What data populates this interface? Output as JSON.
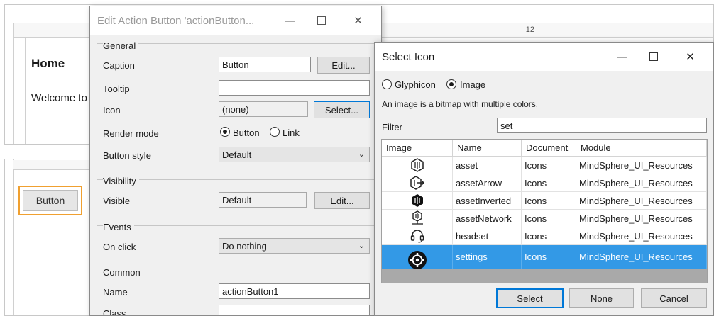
{
  "background": {
    "ruler_number": "12",
    "home_title": "Home",
    "welcome_text": "Welcome to",
    "page_button_label": "Button"
  },
  "edit_dialog": {
    "title": "Edit Action Button 'actionButton...",
    "groups": {
      "general": "General",
      "visibility": "Visibility",
      "events": "Events",
      "common": "Common"
    },
    "fields": {
      "caption_label": "Caption",
      "caption_value": "Button",
      "caption_edit": "Edit...",
      "tooltip_label": "Tooltip",
      "tooltip_value": "",
      "icon_label": "Icon",
      "icon_value": "(none)",
      "icon_select": "Select...",
      "render_mode_label": "Render mode",
      "render_mode_options": [
        "Button",
        "Link"
      ],
      "render_mode_selected": "Button",
      "button_style_label": "Button style",
      "button_style_value": "Default",
      "visible_label": "Visible",
      "visible_value": "Default",
      "visible_edit": "Edit...",
      "on_click_label": "On click",
      "on_click_value": "Do nothing",
      "name_label": "Name",
      "name_value": "actionButton1",
      "class_label": "Class",
      "class_value": ""
    }
  },
  "icon_dialog": {
    "title": "Select Icon",
    "type_options": [
      "Glyphicon",
      "Image"
    ],
    "type_selected": "Image",
    "description": "An image is a bitmap with multiple colors.",
    "filter_label": "Filter",
    "filter_value": "set",
    "columns": [
      "Image",
      "Name",
      "Document",
      "Module"
    ],
    "rows": [
      {
        "name": "asset",
        "document": "Icons",
        "module": "MindSphere_UI_Resources",
        "icon": "asset-icon"
      },
      {
        "name": "assetArrow",
        "document": "Icons",
        "module": "MindSphere_UI_Resources",
        "icon": "asset-arrow-icon"
      },
      {
        "name": "assetInverted",
        "document": "Icons",
        "module": "MindSphere_UI_Resources",
        "icon": "asset-inverted-icon"
      },
      {
        "name": "assetNetwork",
        "document": "Icons",
        "module": "MindSphere_UI_Resources",
        "icon": "asset-network-icon"
      },
      {
        "name": "headset",
        "document": "Icons",
        "module": "MindSphere_UI_Resources",
        "icon": "headset-icon"
      },
      {
        "name": "settings",
        "document": "Icons",
        "module": "MindSphere_UI_Resources",
        "icon": "settings-icon"
      }
    ],
    "selected_row": "settings",
    "buttons": {
      "select": "Select",
      "none": "None",
      "cancel": "Cancel"
    },
    "colors": {
      "selection": "#3399e6",
      "focus_border": "#0078d7"
    }
  }
}
